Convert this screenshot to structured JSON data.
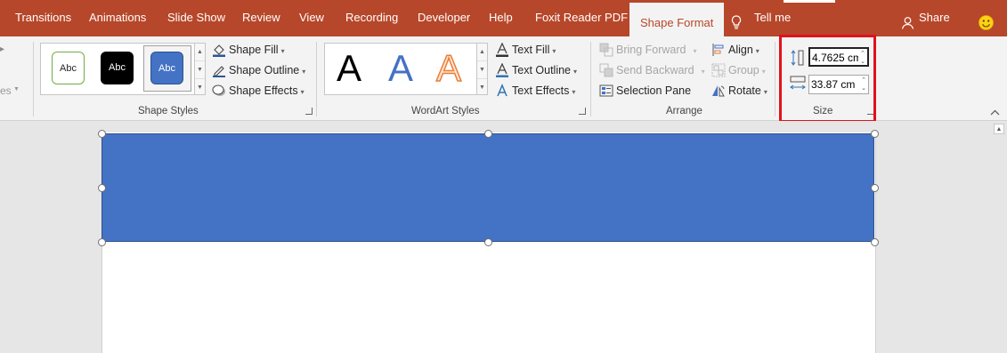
{
  "tabs": [
    {
      "label": "Transitions"
    },
    {
      "label": "Animations"
    },
    {
      "label": "Slide Show"
    },
    {
      "label": "Review"
    },
    {
      "label": "View"
    },
    {
      "label": "Recording"
    },
    {
      "label": "Developer"
    },
    {
      "label": "Help"
    },
    {
      "label": "Foxit Reader PDF"
    },
    {
      "label": "Shape Format"
    }
  ],
  "tell_me": "Tell me",
  "share": "Share",
  "left_cut_label": "es",
  "shape_styles": {
    "group_label": "Shape Styles",
    "thumbs": [
      "Abc",
      "Abc",
      "Abc"
    ],
    "fill": "Shape Fill",
    "outline": "Shape Outline",
    "effects": "Shape Effects"
  },
  "wordart": {
    "group_label": "WordArt Styles",
    "letters": [
      "A",
      "A",
      "A"
    ],
    "text_fill": "Text Fill",
    "text_outline": "Text Outline",
    "text_effects": "Text Effects"
  },
  "arrange": {
    "group_label": "Arrange",
    "bring_forward": "Bring Forward",
    "send_backward": "Send Backward",
    "selection_pane": "Selection Pane",
    "align": "Align",
    "group": "Group",
    "rotate": "Rotate"
  },
  "size": {
    "group_label": "Size",
    "height": "4.7625 cm",
    "width": "33.87 cm"
  },
  "colors": {
    "accent": "#b7472a",
    "shape_fill": "#4472c4",
    "highlight": "#e0121b"
  }
}
